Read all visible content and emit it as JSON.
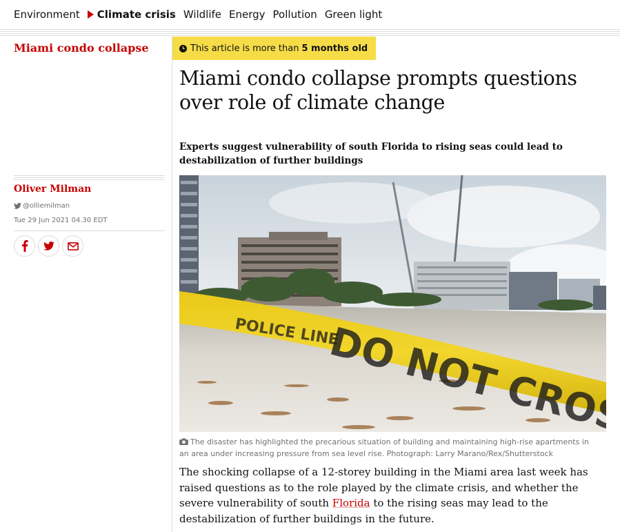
{
  "nav": {
    "items": [
      {
        "label": "Environment",
        "active": false
      },
      {
        "label": "Climate crisis",
        "active": true
      },
      {
        "label": "Wildlife",
        "active": false
      },
      {
        "label": "Energy",
        "active": false
      },
      {
        "label": "Pollution",
        "active": false
      },
      {
        "label": "Green light",
        "active": false
      }
    ]
  },
  "series": {
    "title": "Miami condo collapse"
  },
  "byline": {
    "author": "Oliver Milman",
    "twitter_handle": "@olliemilman",
    "date": "Tue 29 Jun 2021 04.30 EDT"
  },
  "share": {
    "icons": [
      "facebook-icon",
      "twitter-icon",
      "email-icon"
    ]
  },
  "age_warning": {
    "prefix": "This article is more than",
    "age": "5 months old",
    "icon": "clock-icon"
  },
  "article": {
    "headline": "Miami condo collapse prompts questions over role of climate change",
    "standfirst": "Experts suggest vulnerability of south Florida to rising seas could lead to destabilization of further buildings",
    "image": {
      "caption": "The disaster has highlighted the precarious situation of building and maintaining high-rise apartments in an area under increasing pressure from sea level rise. Photograph: Larry Marano/Rex/Shutterstock",
      "tape_text": "DO NOT CROSS",
      "tape_text_small": "POLICE LINE"
    },
    "body": {
      "before_link": "The shocking collapse of a 12-storey building in the Miami area last week has raised questions as to the role played by the climate crisis, and whether the severe vulnerability of south ",
      "link": "Florida",
      "after_link": " to the rising seas may lead to the destabilization of further buildings in the future."
    }
  },
  "colors": {
    "accent_red": "#c70000",
    "badge_yellow": "#f6dd48",
    "rule_gray": "#dcdcdc",
    "meta_gray": "#707070"
  }
}
